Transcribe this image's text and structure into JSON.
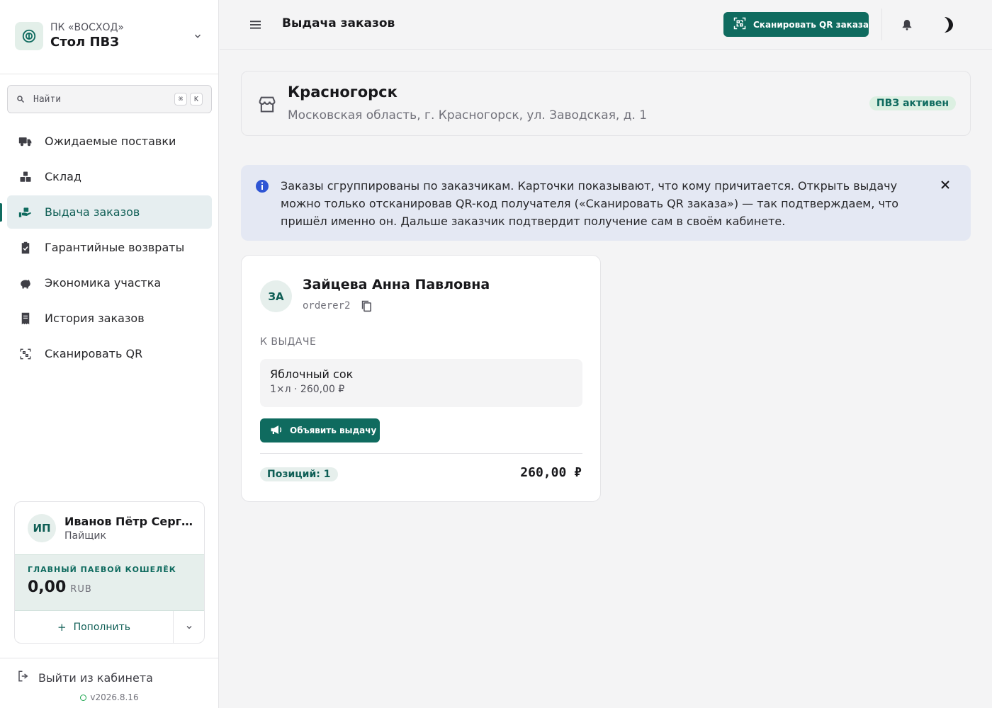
{
  "colors": {
    "brand": "#0f6b5f",
    "brand_light": "#e6efec",
    "info_bg": "#e4e8f3",
    "active_badge": "#dcf0e2"
  },
  "sidebar": {
    "org_name": "ПК «ВОСХОД»",
    "org_title": "Стол ПВЗ",
    "search": {
      "placeholder": "Найти",
      "kbd_mod": "⌘",
      "kbd_key": "K"
    },
    "items": [
      {
        "label": "Ожидаемые поставки",
        "icon": "truck-icon"
      },
      {
        "label": "Склад",
        "icon": "boxes-icon"
      },
      {
        "label": "Выдача заказов",
        "icon": "hand-package-icon",
        "active": true
      },
      {
        "label": "Гарантийные возвраты",
        "icon": "clipboard-check-icon"
      },
      {
        "label": "Экономика участка",
        "icon": "piggy-bank-icon"
      },
      {
        "label": "История заказов",
        "icon": "receipt-icon"
      },
      {
        "label": "Сканировать QR",
        "icon": "qr-scan-icon"
      }
    ],
    "user": {
      "initials": "ИП",
      "name": "Иванов Пётр Сергеевич",
      "role": "Пайщик",
      "wallet_label": "ГЛАВНЫЙ ПАЕВОЙ КОШЕЛЁК",
      "balance": "0,00",
      "currency": "RUB",
      "topup_label": "Пополнить"
    },
    "logout_label": "Выйти из кабинета",
    "version": "v2026.8.16"
  },
  "header": {
    "title": "Выдача заказов",
    "scan_label": "Сканировать QR заказа"
  },
  "location": {
    "city": "Красногорск",
    "address": "Московская область, г. Красногорск, ул. Заводская, д. 1",
    "status": "ПВЗ активен"
  },
  "info": {
    "text": "Заказы сгруппированы по заказчикам. Карточки показывают, что кому причитается. Открыть выдачу можно только отсканировав QR-код получателя («Сканировать QR заказа») — так подтверждаем, что пришёл именно он. Дальше заказчик подтвердит получение сам в своём кабинете."
  },
  "order": {
    "initials": "ЗА",
    "customer_name": "Зайцева Анна Павловна",
    "login": "orderer2",
    "section_label": "К ВЫДАЧЕ",
    "items": [
      {
        "name": "Яблочный сок",
        "meta": "1×л · 260,00 ₽"
      }
    ],
    "announce_label": "Объявить выдачу",
    "positions": "Позиций: 1",
    "total": "260,00 ₽"
  }
}
